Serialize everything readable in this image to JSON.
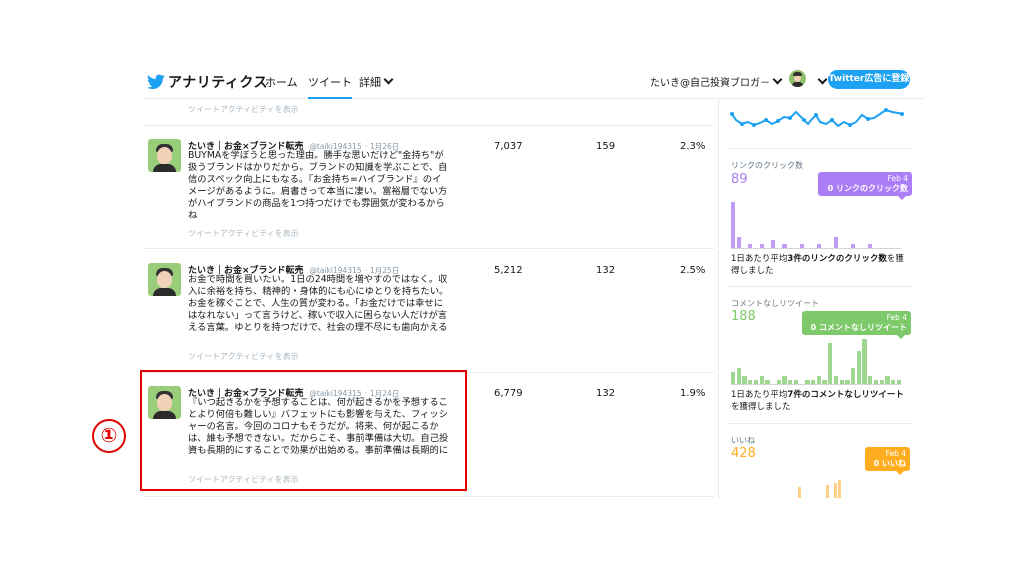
{
  "nav": {
    "title": "アナリティクス",
    "links": [
      "ホーム",
      "ツイート",
      "詳細"
    ],
    "account": "たいき@自己投資ブロガ－",
    "ad_button": "Twitter広告に登録"
  },
  "activity_label": "ツイートアクティビティを表示",
  "tweets": [
    {
      "name": "たいき｜お金×ブランド転売",
      "handle": "@taiki194315",
      "date": "1月26日",
      "text": "BUYMAを学ぼうと思った理由。勝手な思いだけど\"金持ち\"が扱うブランドはかりだから。ブランドの知識を学ぶことで、自信のスペック向上にもなる。『お金持ち=ハイブランド』のイメージがあるように。肩書きって本当に凄い。富裕層でない方がハイブランドの商品を1つ持つだけでも雰囲気が変わるからね",
      "impressions": "7,037",
      "engagements": "159",
      "rate": "2.3%"
    },
    {
      "name": "たいき｜お金×ブランド転売",
      "handle": "@taiki194315",
      "date": "1月25日",
      "text": "お金で時間を買いたい。1日の24時間を増やすのではなく。収入に余裕を持ち、精神的・身体的にも心にゆとりを持ちたい。お金を稼ぐことで、人生の質が変わる。「お金だけでは幸せにはなれない」って言うけど、稼いで収入に困らない人だけが言える言葉。ゆとりを持つだけで、社会の理不尽にも歯向かえる",
      "impressions": "5,212",
      "engagements": "132",
      "rate": "2.5%"
    },
    {
      "name": "たいき｜お金×ブランド転売",
      "handle": "@taiki194315",
      "date": "1月24日",
      "text": "『いつ起きるかを予想することは、何が起きるかを予想することより何倍も難しい』バフェットにも影響を与えた、フィッシャーの名言。今回のコロナもそうだが。将来、何が起こるかは、誰も予想できない。だからこそ、事前準備は大切。自己投資も長期的にすることで効果が出始める。事前準備は長期的に",
      "impressions": "6,779",
      "engagements": "132",
      "rate": "1.9%"
    }
  ],
  "marker": "①",
  "sidebar": {
    "link_clicks": {
      "title": "リンクのクリック数",
      "value": "89",
      "tip_date": "Feb 4",
      "tip_text": "0 リンクのクリック数",
      "desc_prefix": "1日あたり平均",
      "desc_bold": "3件のリンクのクリック数",
      "desc_suffix": "を獲得しました",
      "bars": [
        12,
        3,
        0,
        1,
        0,
        1,
        0,
        2,
        0,
        1,
        0,
        0,
        1,
        0,
        0,
        1,
        0,
        0,
        3,
        0,
        0,
        1,
        0,
        0,
        1,
        0,
        0,
        0,
        0,
        0
      ]
    },
    "retweets": {
      "title": "コメントなしリツイート",
      "value": "188",
      "tip_date": "Feb 4",
      "tip_text": "0 コメントなしリツイート",
      "desc_prefix": "1日あたり平均",
      "desc_bold": "7件のコメントなしリツイート",
      "desc_suffix": "を獲得しました",
      "bars": [
        3,
        4,
        2,
        1,
        1,
        2,
        1,
        0,
        1,
        2,
        1,
        1,
        0,
        1,
        1,
        2,
        1,
        10,
        2,
        1,
        1,
        4,
        8,
        11,
        2,
        1,
        1,
        2,
        1,
        1
      ]
    },
    "likes": {
      "title": "いいね",
      "value": "428",
      "tip_date": "Feb 4",
      "tip_text": "0 いいね"
    },
    "colors": {
      "purple": "#ab7df6",
      "green": "#7ec969",
      "orange": "#ffad1f",
      "blue": "#1da1f2"
    }
  }
}
